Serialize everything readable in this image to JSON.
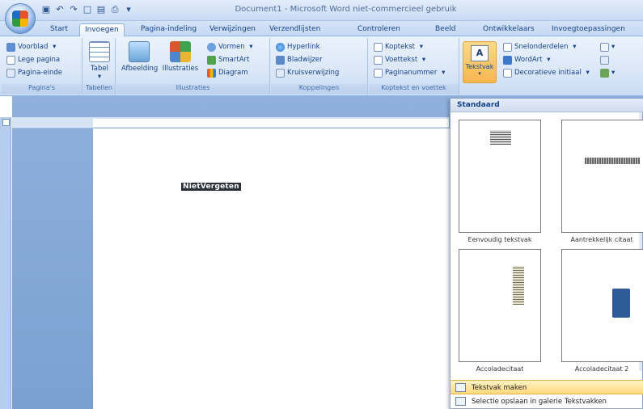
{
  "window": {
    "title": "Document1 - Microsoft Word niet-commercieel gebruik"
  },
  "tabs": [
    "Start",
    "Invoegen",
    "Pagina-indeling",
    "Verwijzingen",
    "Verzendlijsten",
    "Controleren",
    "Beeld",
    "Ontwikkelaars",
    "Invoegtoepassingen"
  ],
  "active_tab": "Invoegen",
  "ribbon": {
    "paginas": {
      "label": "Pagina's",
      "items": [
        "Voorblad",
        "Lege pagina",
        "Pagina-einde"
      ]
    },
    "tabellen": {
      "label": "Tabellen",
      "tabel": "Tabel"
    },
    "illustraties": {
      "label": "Illustraties",
      "afbeelding": "Afbeelding",
      "illustraties": "Illustraties",
      "vormen": "Vormen",
      "smartart": "SmartArt",
      "diagram": "Diagram"
    },
    "koppelingen": {
      "label": "Koppelingen",
      "items": [
        "Hyperlink",
        "Bladwijzer",
        "Kruisverwijzing"
      ]
    },
    "koptekst": {
      "label": "Koptekst en voettek",
      "items": [
        "Koptekst",
        "Voettekst",
        "Paginanummer"
      ]
    },
    "tekst": {
      "tekstvak": "Tekstvak",
      "items": [
        "Snelonderdelen",
        "WordArt",
        "Decoratieve initiaal"
      ]
    }
  },
  "document": {
    "selected_text": "NietVergeten"
  },
  "gallery": {
    "header": "Standaard",
    "thumbs": [
      "Eenvoudig tekstvak",
      "Aantrekkelijk citaat",
      "Accoladecitaat",
      "Accoladecitaat 2"
    ],
    "footer": [
      "Tekstvak maken",
      "Selectie opslaan in galerie Tekstvakken"
    ]
  }
}
